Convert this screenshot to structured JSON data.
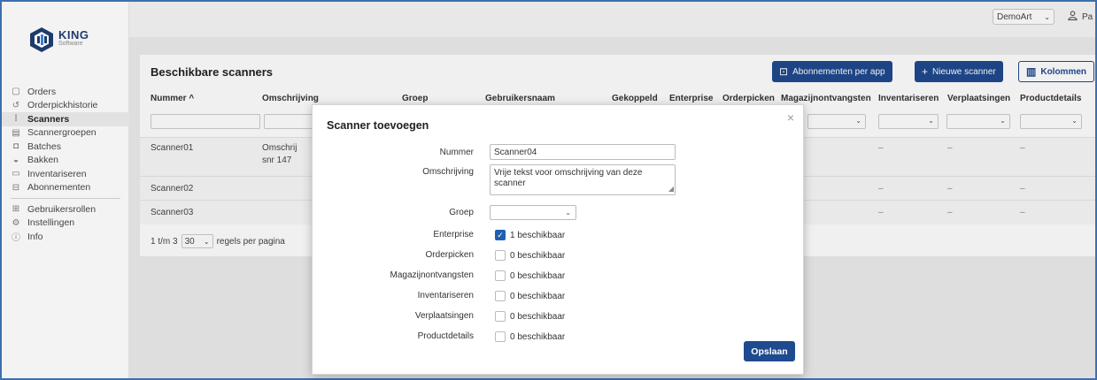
{
  "brand": {
    "name": "KING",
    "sub": "Software"
  },
  "sidebar": {
    "items": [
      {
        "label": "Orders",
        "icon": "document-icon"
      },
      {
        "label": "Orderpickhistorie",
        "icon": "history-icon"
      },
      {
        "label": "Scanners",
        "icon": "barcode-icon",
        "active": true
      },
      {
        "label": "Scannergroepen",
        "icon": "group-icon"
      },
      {
        "label": "Batches",
        "icon": "batch-icon"
      },
      {
        "label": "Bakken",
        "icon": "bin-icon"
      },
      {
        "label": "Inventariseren",
        "icon": "inventory-icon"
      },
      {
        "label": "Abonnementen",
        "icon": "subscription-icon"
      }
    ],
    "items2": [
      {
        "label": "Gebruikersrollen",
        "icon": "users-icon"
      },
      {
        "label": "Instellingen",
        "icon": "settings-icon"
      },
      {
        "label": "Info",
        "icon": "info-icon"
      }
    ]
  },
  "topbar": {
    "company": "DemoArt",
    "user": "Pa"
  },
  "page": {
    "title": "Beschikbare scanners",
    "btn_subscriptions": "Abonnementen per app",
    "btn_new": "Nieuwe scanner",
    "btn_columns": "Kolommen"
  },
  "table": {
    "headers": [
      "Nummer ^",
      "Omschrijving",
      "Groep",
      "Gebruikersnaam",
      "Gekoppeld",
      "Enterprise",
      "Orderpicken",
      "Magazijnontvangsten",
      "Inventariseren",
      "Verplaatsingen",
      "Productdetails"
    ],
    "rows": [
      {
        "nummer": "Scanner01",
        "omschrijving1": "Omschrij",
        "omschrijving2": "snr 147",
        "dash": "–"
      },
      {
        "nummer": "Scanner02",
        "dash": "–"
      },
      {
        "nummer": "Scanner03",
        "dash": "–"
      }
    ],
    "pager": {
      "range": "1 t/m 3",
      "per_page": "30",
      "suffix": "regels per pagina"
    }
  },
  "modal": {
    "title": "Scanner toevoegen",
    "close": "×",
    "fields": {
      "nummer_label": "Nummer",
      "nummer_value": "Scanner04",
      "omschrijving_label": "Omschrijving",
      "omschrijving_value": "Vrije tekst voor omschrijving van deze scanner",
      "groep_label": "Groep"
    },
    "licenses": [
      {
        "label": "Enterprise",
        "text": "1 beschikbaar",
        "checked": true
      },
      {
        "label": "Orderpicken",
        "text": "0 beschikbaar",
        "checked": false
      },
      {
        "label": "Magazijnontvangsten",
        "text": "0 beschikbaar",
        "checked": false
      },
      {
        "label": "Inventariseren",
        "text": "0 beschikbaar",
        "checked": false
      },
      {
        "label": "Verplaatsingen",
        "text": "0 beschikbaar",
        "checked": false
      },
      {
        "label": "Productdetails",
        "text": "0 beschikbaar",
        "checked": false
      }
    ],
    "save": "Opslaan"
  },
  "colors": {
    "primary": "#1f4a8f",
    "checkbox": "#1f5fb0",
    "frame": "#3c6fb0"
  }
}
